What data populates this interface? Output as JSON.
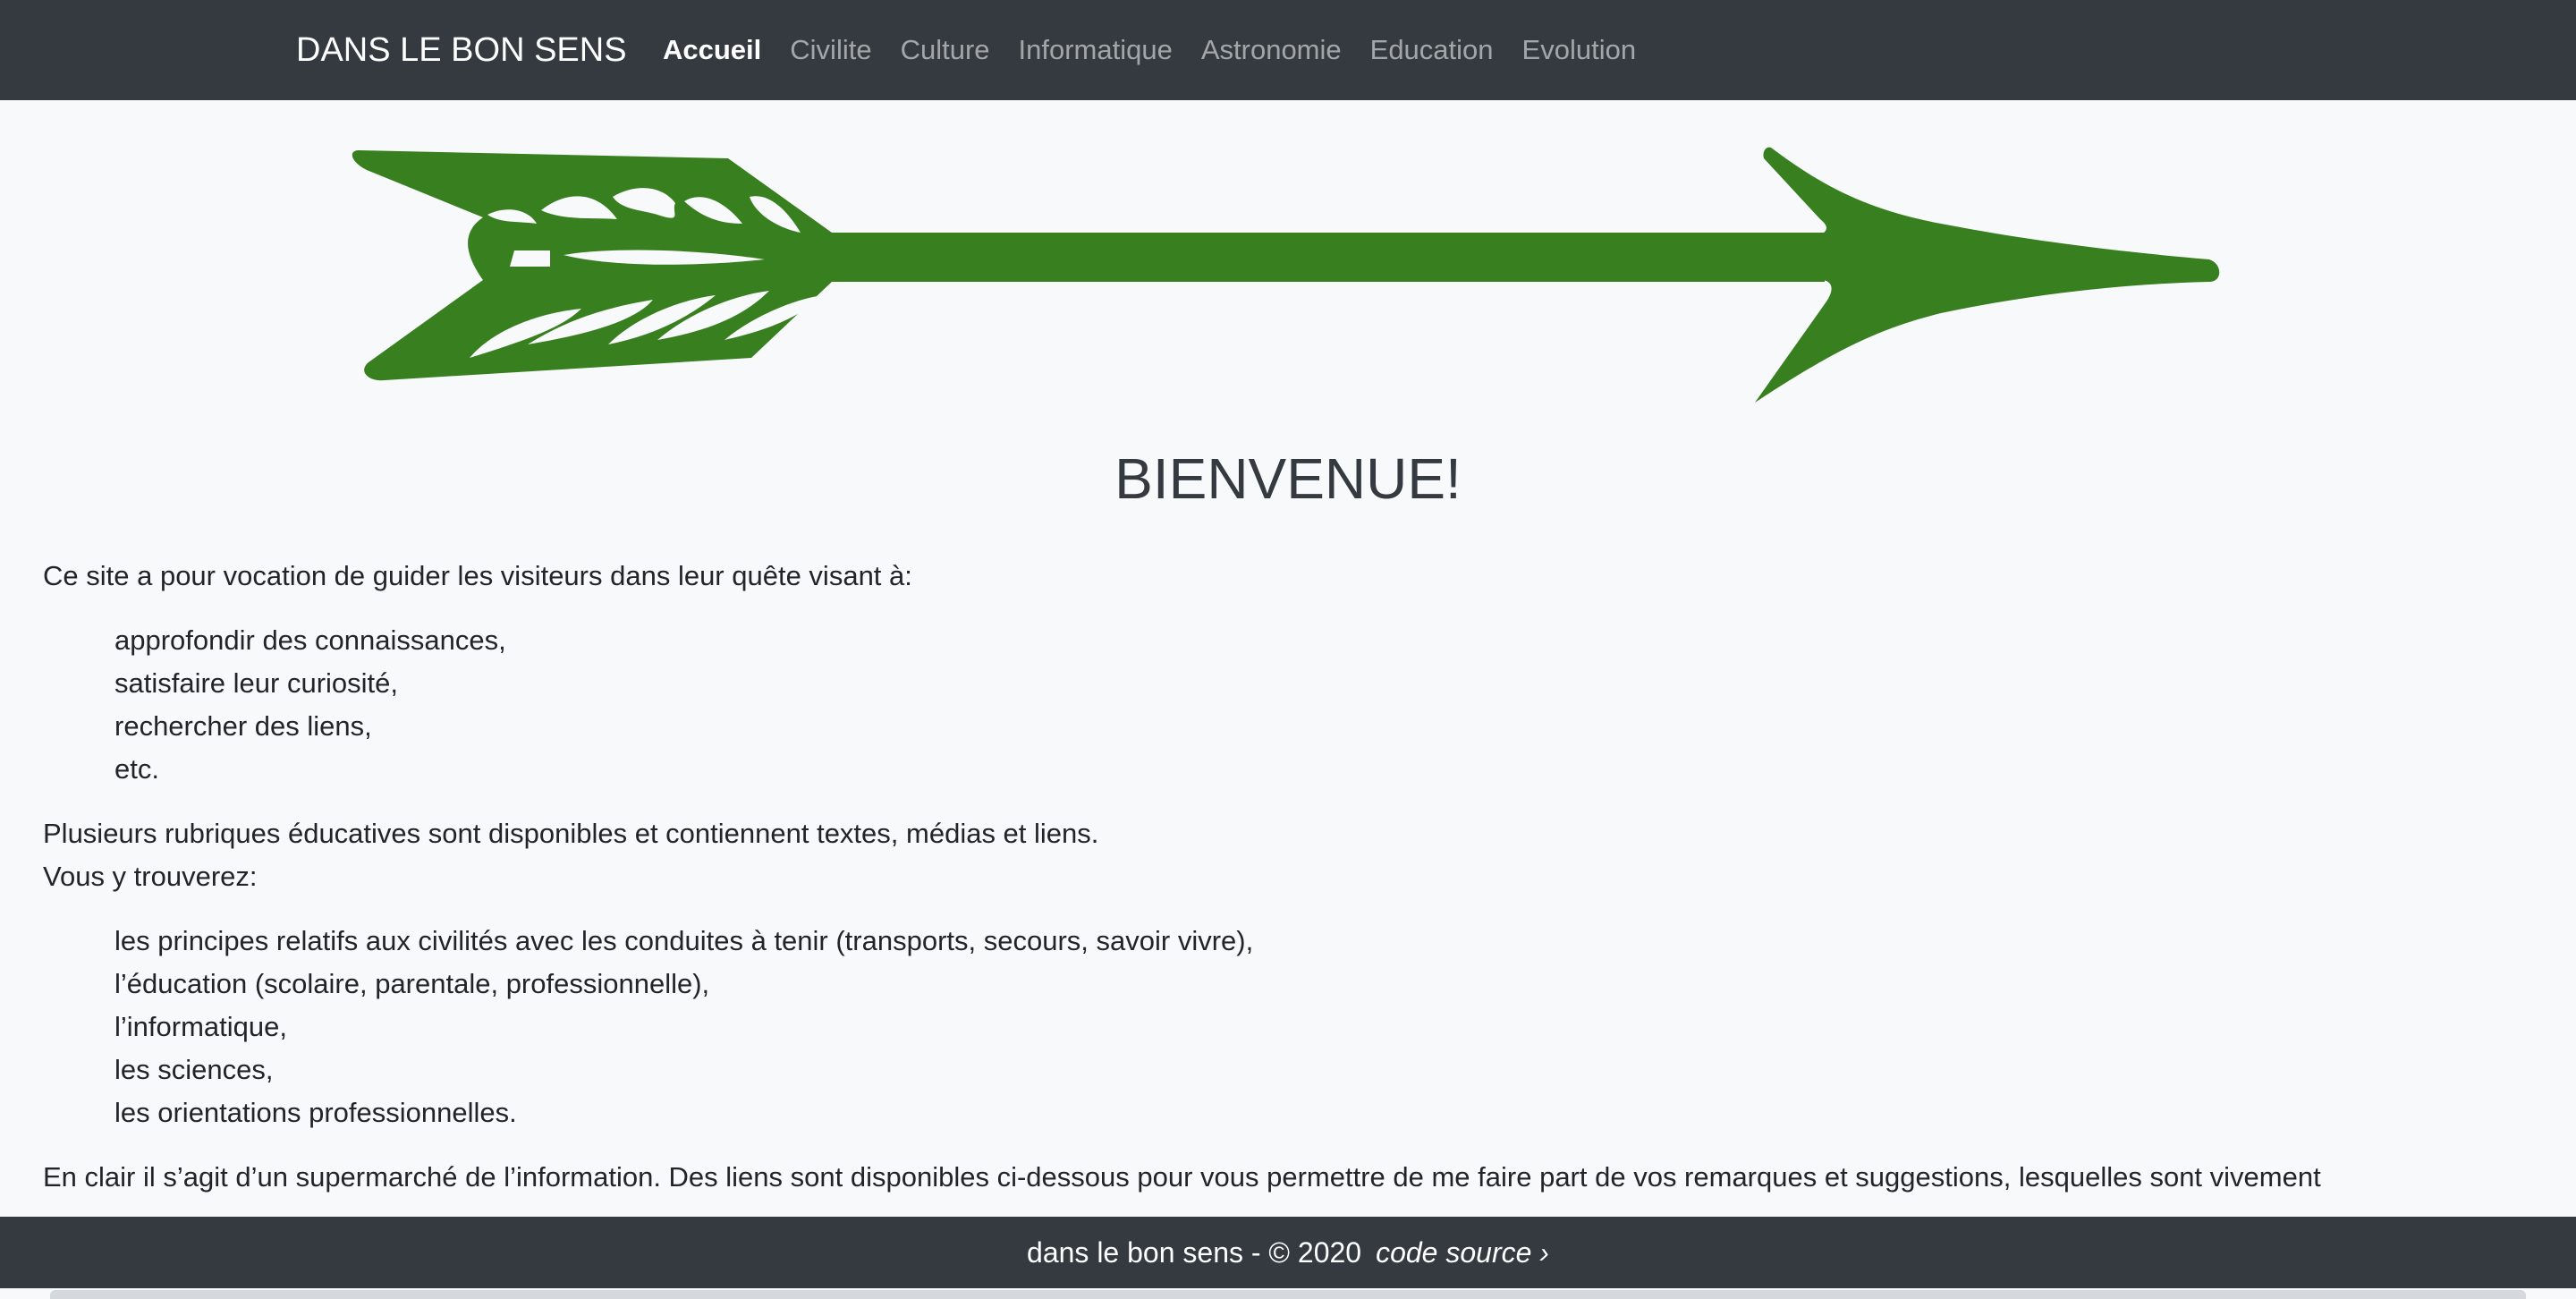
{
  "navbar": {
    "brand": "DANS LE BON SENS",
    "links": [
      {
        "label": "Accueil",
        "active": true
      },
      {
        "label": "Civilite",
        "active": false
      },
      {
        "label": "Culture",
        "active": false
      },
      {
        "label": "Informatique",
        "active": false
      },
      {
        "label": "Astronomie",
        "active": false
      },
      {
        "label": "Education",
        "active": false
      },
      {
        "label": "Evolution",
        "active": false
      }
    ]
  },
  "hero": {
    "image": "green-arrow",
    "arrow_color": "#38801f"
  },
  "main": {
    "title": "BIENVENUE!",
    "intro": "Ce site a pour vocation de guider les visiteurs dans leur quête visant à:",
    "goals": [
      "approfondir des connaissances,",
      "satisfaire leur curiosité,",
      "rechercher des liens,",
      "etc."
    ],
    "sections_intro_1": "Plusieurs rubriques éducatives sont disponibles et contiennent textes, médias et liens.",
    "sections_intro_2": "Vous y trouverez:",
    "topics": [
      "les principes relatifs aux civilités avec les conduites à tenir (transports, secours, savoir vivre),",
      "l’éducation (scolaire, parentale, professionnelle),",
      "l’informatique,",
      "les sciences,",
      "les orientations professionnelles."
    ],
    "closing": "En clair il s’agit d’un supermarché de l’information. Des liens sont disponibles ci-dessous pour vous permettre de me faire part de vos remarques et suggestions, lesquelles sont vivement"
  },
  "footer": {
    "text": "dans le bon sens - © 2020",
    "source_link": "code source ›"
  }
}
